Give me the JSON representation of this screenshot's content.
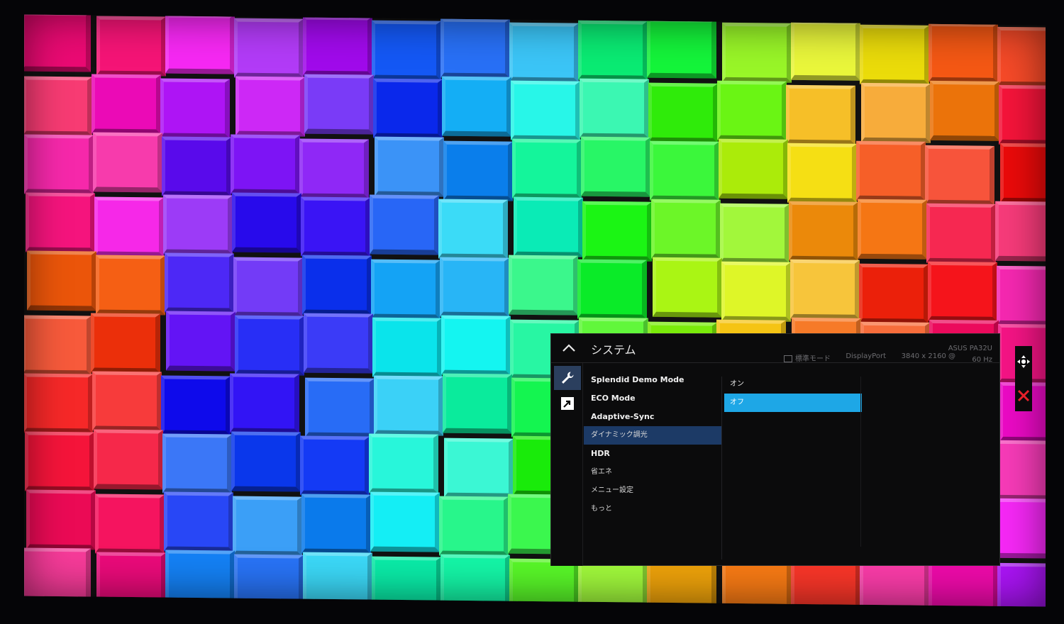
{
  "osd": {
    "title": "システム",
    "status": {
      "mode": "標準モード",
      "input": "DisplayPort",
      "resolution": "3840 x 2160 @",
      "model": "ASUS PA32U",
      "refresh": "60 Hz"
    },
    "tabs": [
      {
        "icon": "wrench-icon",
        "active": true
      },
      {
        "icon": "shortcut-arrow-icon",
        "active": false
      }
    ],
    "menu_items": [
      {
        "label": "Splendid Demo Mode"
      },
      {
        "label": "ECO Mode"
      },
      {
        "label": "Adaptive-Sync"
      },
      {
        "label": "ダイナミック調光",
        "selected": true
      },
      {
        "label": "HDR"
      },
      {
        "label": "省エネ"
      },
      {
        "label": "メニュー設定"
      },
      {
        "label": "もっと"
      }
    ],
    "options": [
      {
        "label": "オン"
      },
      {
        "label": "オフ",
        "selected": true
      }
    ],
    "colors": {
      "selected_menu": "#1c3a66",
      "selected_option": "#1ea7e6",
      "close": "#e8202a"
    }
  },
  "nav": {
    "icons": [
      "dpad-icon",
      "close-icon"
    ]
  }
}
